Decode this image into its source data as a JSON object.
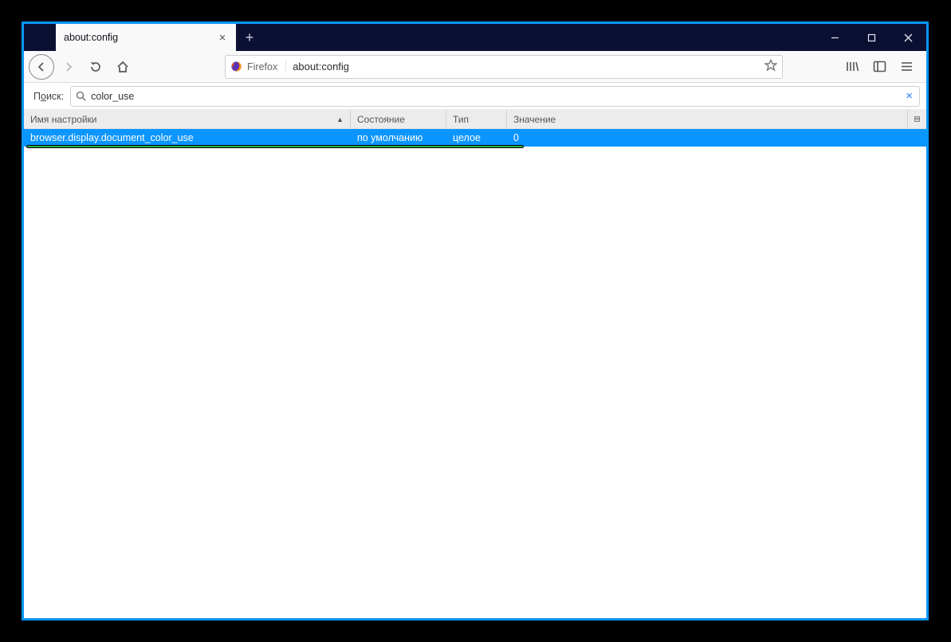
{
  "window": {
    "tab_title": "about:config"
  },
  "urlbar": {
    "identity_label": "Firefox",
    "url": "about:config"
  },
  "search": {
    "label_prefix": "П",
    "label_underlined": "о",
    "label_suffix": "иск:",
    "value": "color_use"
  },
  "columns": {
    "name": "Имя настройки",
    "state": "Состояние",
    "type": "Тип",
    "value": "Значение"
  },
  "row": {
    "name": "browser.display.document_color_use",
    "state": "по умолчанию",
    "type": "целое",
    "value": "0"
  }
}
